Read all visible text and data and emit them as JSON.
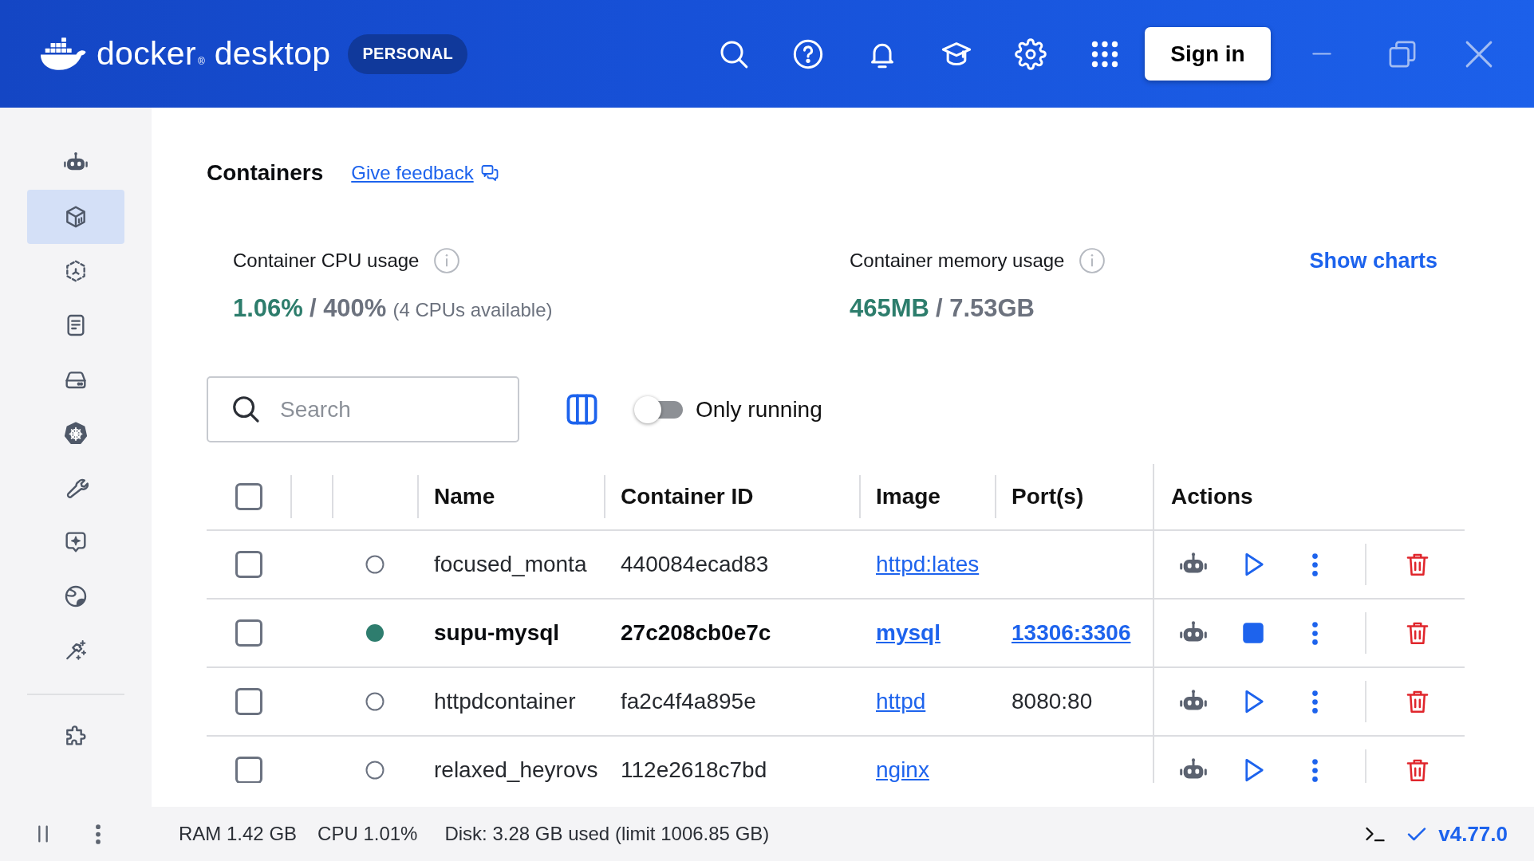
{
  "title_bar": {
    "logo": {
      "brand": "docker",
      "mark": "®",
      "product": "desktop"
    },
    "plan_badge": "PERSONAL",
    "sign_in_button": "Sign in"
  },
  "sidebar": {
    "items": [
      {
        "selected": false
      },
      {
        "selected": true
      },
      {
        "selected": false
      },
      {
        "selected": false
      },
      {
        "selected": false
      },
      {
        "selected": false
      },
      {
        "selected": false
      },
      {
        "selected": false
      },
      {
        "selected": false
      },
      {
        "selected": false
      }
    ],
    "bottom_items": [
      {
        "selected": false
      }
    ]
  },
  "page": {
    "title": "Containers",
    "feedback_link": "Give feedback"
  },
  "usage": {
    "cpu": {
      "label": "Container CPU usage",
      "used": "1.06%",
      "limit": "/ 400%",
      "note": "(4 CPUs available)"
    },
    "memory": {
      "label": "Container memory usage",
      "used": "465MB",
      "limit": "/ 7.53GB"
    },
    "show_charts_link": "Show charts"
  },
  "toolbar": {
    "search": {
      "placeholder": "Search"
    },
    "only_running": {
      "label": "Only running",
      "on": false
    }
  },
  "table": {
    "select_all": {
      "checked": false
    },
    "columns": [
      "Name",
      "Container ID",
      "Image",
      "Port(s)",
      "Actions"
    ],
    "rows": [
      {
        "checked": false,
        "running": false,
        "name": "focused_monta",
        "container_id": "440084ecad83",
        "image": "httpd:lates"
      },
      {
        "checked": false,
        "running": true,
        "name": "supu-mysql",
        "container_id": "27c208cb0e7c",
        "image": "mysql",
        "ports": "13306:3306"
      },
      {
        "checked": false,
        "running": false,
        "name": "httpdcontainer",
        "container_id": "fa2c4f4a895e",
        "image": "httpd",
        "ports": "8080:80"
      },
      {
        "checked": false,
        "running": false,
        "name": "relaxed_heyrovs",
        "container_id": "112e2618c7bd",
        "image": "nginx"
      }
    ]
  },
  "status_bar": {
    "ram": "RAM 1.42 GB",
    "cpu": "CPU 1.01%",
    "disk": "Disk: 3.28 GB used (limit 1006.85 GB)",
    "version": "v4.77.0"
  }
}
